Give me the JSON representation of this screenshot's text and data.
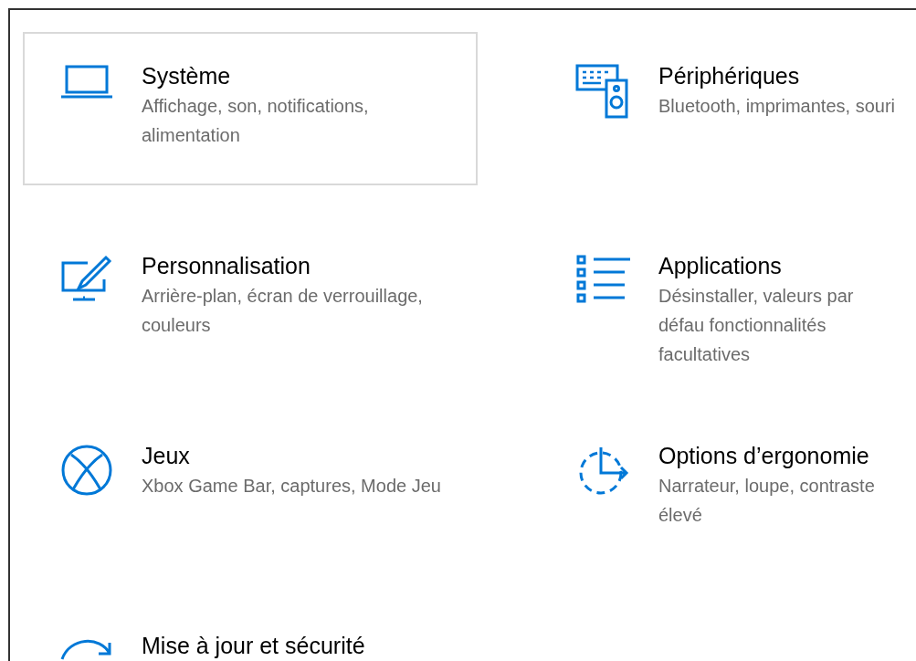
{
  "tiles": [
    {
      "kind": "laptop",
      "title": "Système",
      "description": "Affichage, son, notifications, alimentation",
      "selected": true
    },
    {
      "kind": "devices",
      "title": "Périphériques",
      "description": "Bluetooth, imprimantes, souri",
      "selected": false
    },
    {
      "kind": "personalization",
      "title": "Personnalisation",
      "description": "Arrière-plan, écran de verrouillage, couleurs",
      "selected": false
    },
    {
      "kind": "apps",
      "title": "Applications",
      "description": "Désinstaller, valeurs par défau fonctionnalités facultatives",
      "selected": false
    },
    {
      "kind": "gaming",
      "title": "Jeux",
      "description": "Xbox Game Bar, captures, Mode Jeu",
      "selected": false
    },
    {
      "kind": "accessibility",
      "title": "Options d’ergonomie",
      "description": "Narrateur, loupe, contraste élevé",
      "selected": false
    },
    {
      "kind": "update",
      "title": "Mise à jour et sécurité",
      "selected": false
    }
  ]
}
